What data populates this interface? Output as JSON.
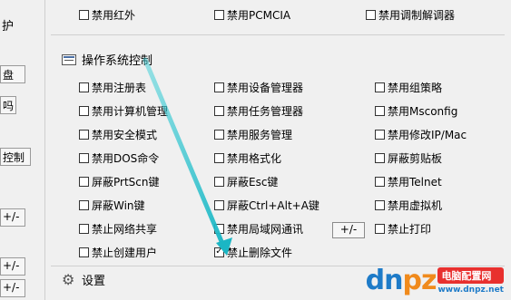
{
  "left": {
    "label_hu": "护",
    "btn_pan": "盘",
    "btn_ma": "吗",
    "btn_kongzhi": "控制",
    "btn_pm1": "+/-",
    "btn_pm2": "+/-",
    "btn_pm3": "+/-"
  },
  "top_row": [
    "禁用红外",
    "禁用PCMCIA",
    "禁用调制解调器"
  ],
  "os_control": {
    "title": "操作系统控制",
    "col1": [
      "禁用注册表",
      "禁用计算机管理",
      "禁用安全模式",
      "禁用DOS命令",
      "屏蔽PrtScn键",
      "屏蔽Win键",
      "禁止网络共享",
      "禁止创建用户"
    ],
    "col2": [
      "禁用设备管理器",
      "禁用任务管理器",
      "禁用服务管理",
      "禁用格式化",
      "屏蔽Esc键",
      "屏蔽Ctrl+Alt+A键",
      "禁用局域网通讯",
      "禁止删除文件"
    ],
    "col3": [
      "禁用组策略",
      "禁用Msconfig",
      "禁用修改IP/Mac",
      "屏蔽剪贴板",
      "禁用Telnet",
      "禁用虚拟机",
      "禁止打印"
    ],
    "checked": [
      "禁止删除文件"
    ],
    "pm_button": "+/-"
  },
  "settings": {
    "title": "设置"
  },
  "watermark": {
    "logo_a": "dn",
    "logo_b": "pz",
    "logo_c": ".net",
    "tag": "电脑配置网",
    "url": "www.dnpz.net"
  }
}
